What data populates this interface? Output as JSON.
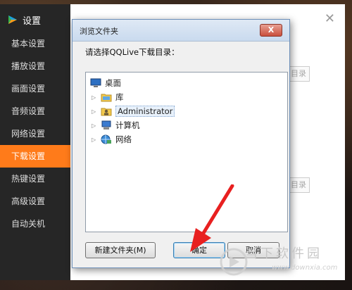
{
  "settings": {
    "title": "设置",
    "close_icon": "close-x",
    "items": [
      {
        "label": "基本设置"
      },
      {
        "label": "播放设置"
      },
      {
        "label": "画面设置"
      },
      {
        "label": "音频设置"
      },
      {
        "label": "网络设置"
      },
      {
        "label": "下载设置",
        "active": true
      },
      {
        "label": "热键设置"
      },
      {
        "label": "高级设置"
      },
      {
        "label": "自动关机"
      }
    ],
    "bg_buttons": [
      "目录",
      "目录"
    ],
    "accent": "#ff7b1a"
  },
  "dialog": {
    "title": "浏览文件夹",
    "close_label": "X",
    "prompt": "请选择QQLive下载目录：",
    "tree": [
      {
        "label": "桌面",
        "icon": "desktop-icon"
      },
      {
        "label": "库",
        "icon": "library-icon"
      },
      {
        "label": "Administrator",
        "icon": "user-folder-icon",
        "selected": true
      },
      {
        "label": "计算机",
        "icon": "computer-icon"
      },
      {
        "label": "网络",
        "icon": "network-icon"
      }
    ],
    "buttons": {
      "new_folder": "新建文件夹(M)",
      "ok": "确定",
      "cancel": "取消"
    }
  },
  "watermark": {
    "text": "当下软件园",
    "url": "www.downxia.com"
  }
}
